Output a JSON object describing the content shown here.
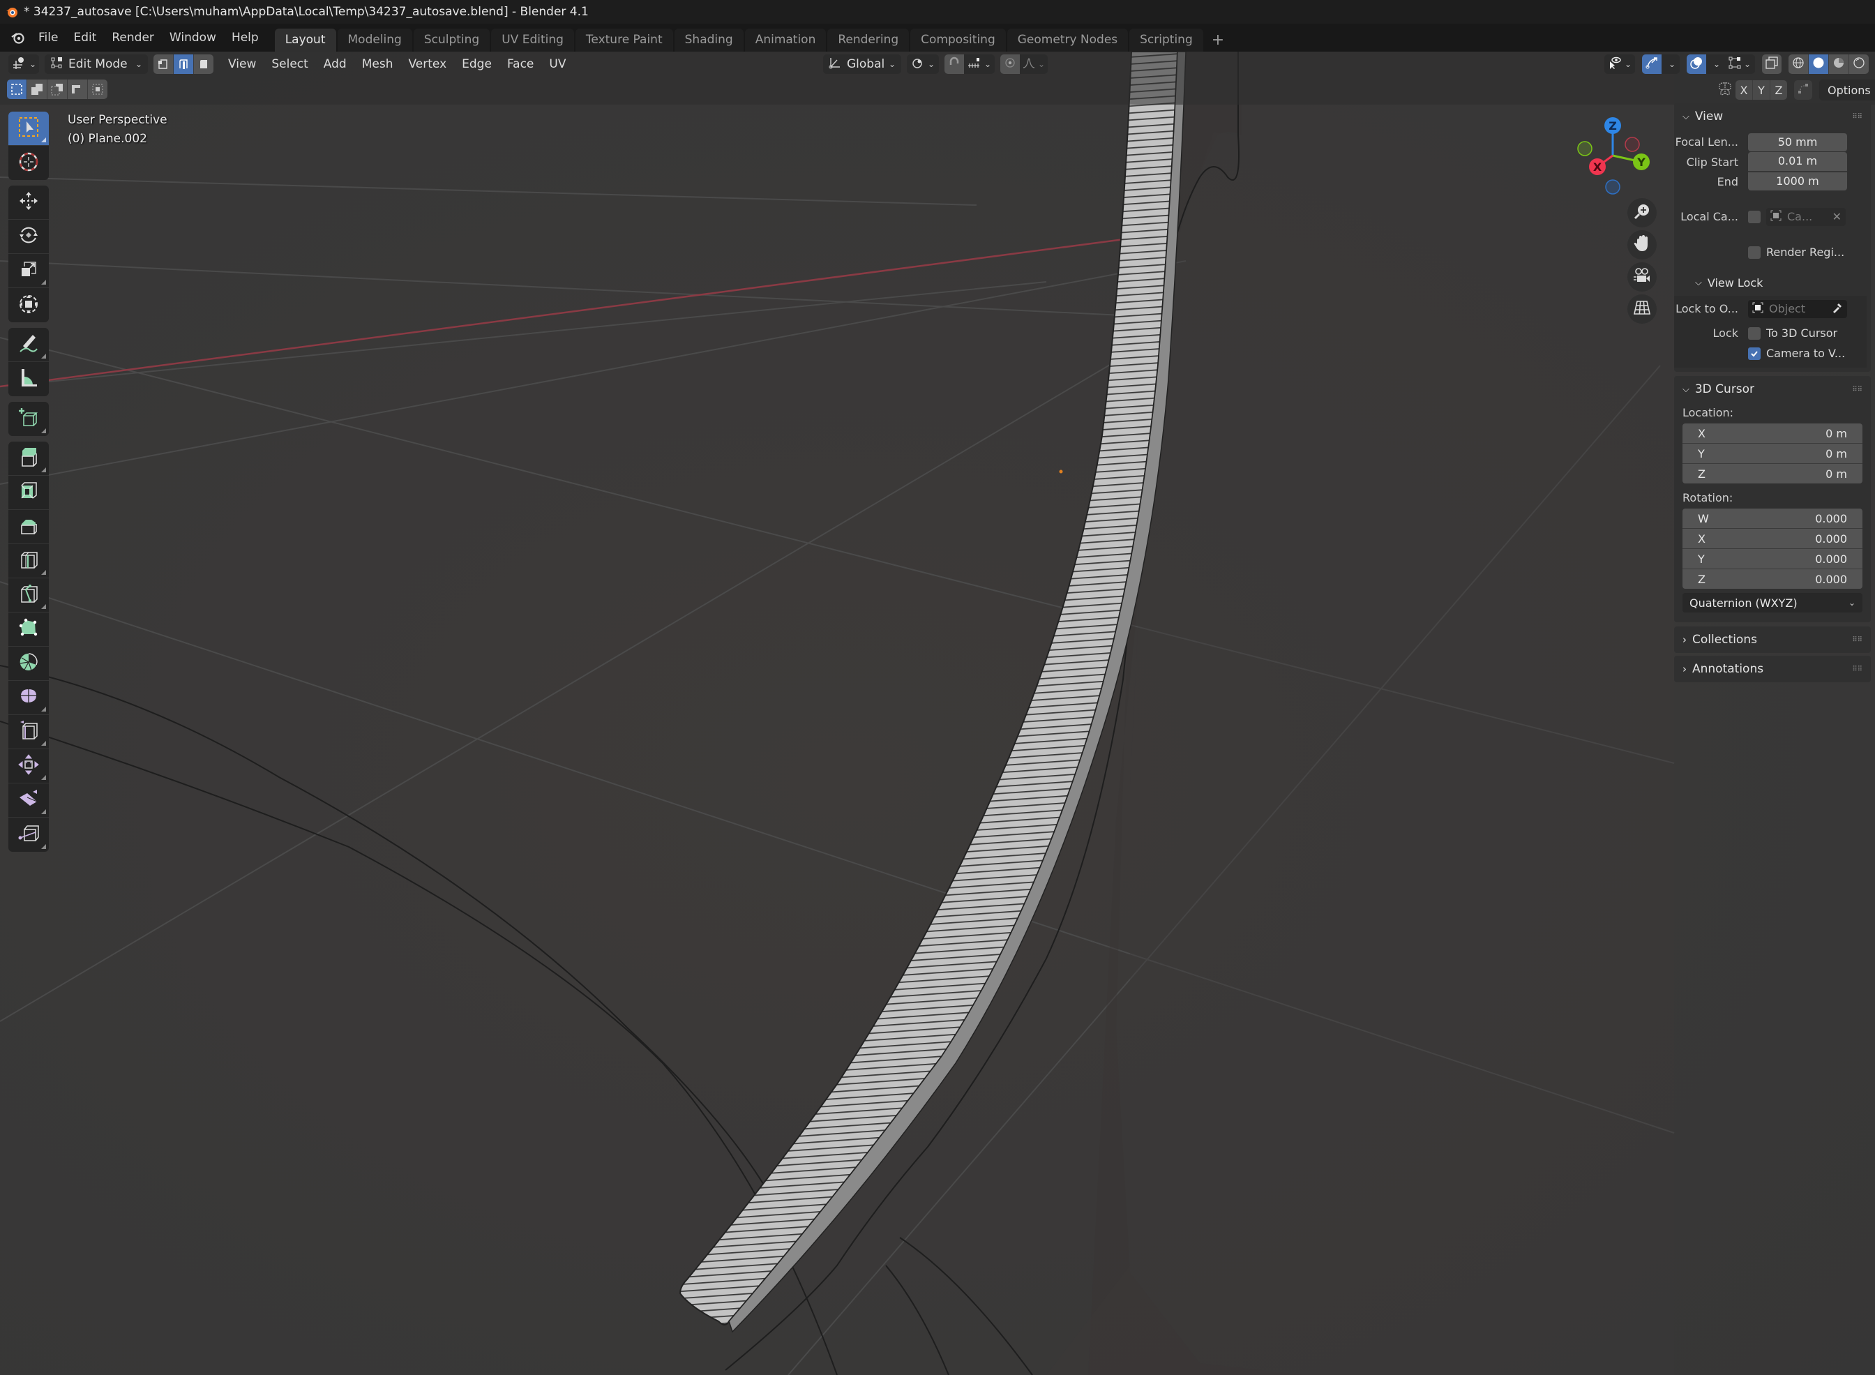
{
  "window": {
    "title": "* 34237_autosave [C:\\Users\\muham\\AppData\\Local\\Temp\\34237_autosave.blend] - Blender 4.1",
    "app_icon": "blender-logo-icon"
  },
  "menubar": {
    "items": [
      "File",
      "Edit",
      "Render",
      "Window",
      "Help"
    ]
  },
  "workspaces": {
    "tabs": [
      {
        "label": "Layout",
        "active": true
      },
      {
        "label": "Modeling",
        "active": false
      },
      {
        "label": "Sculpting",
        "active": false
      },
      {
        "label": "UV Editing",
        "active": false
      },
      {
        "label": "Texture Paint",
        "active": false
      },
      {
        "label": "Shading",
        "active": false
      },
      {
        "label": "Animation",
        "active": false
      },
      {
        "label": "Rendering",
        "active": false
      },
      {
        "label": "Compositing",
        "active": false
      },
      {
        "label": "Geometry Nodes",
        "active": false
      },
      {
        "label": "Scripting",
        "active": false
      }
    ],
    "add_label": "+"
  },
  "viewport_header": {
    "editor_type_icon": "3d-viewport-icon",
    "mode": "Edit Mode",
    "select_modes": [
      {
        "name": "vertex-select",
        "active": false
      },
      {
        "name": "edge-select",
        "active": true
      },
      {
        "name": "face-select",
        "active": false
      }
    ],
    "menus": [
      "View",
      "Select",
      "Add",
      "Mesh",
      "Vertex",
      "Edge",
      "Face",
      "UV"
    ],
    "transform_orientation": "Global",
    "pivot_icon": "pivot-point-icon",
    "snap_icon": "snap-magnet-icon",
    "snap_target_icon": "snap-increment-icon",
    "proportional_icon": "proportional-edit-icon",
    "falloff_icon": "falloff-curve-icon",
    "right_icons": [
      "visibility-selectability-icon",
      "gizmo-toggle-icon",
      "overlay-toggle-icon",
      "mesh-edit-overlay-icon",
      "xray-toggle-icon"
    ],
    "shading_modes": [
      {
        "name": "wireframe",
        "active": false
      },
      {
        "name": "solid",
        "active": true
      },
      {
        "name": "material-preview",
        "active": false
      },
      {
        "name": "rendered",
        "active": false
      }
    ]
  },
  "tool_settings": {
    "select_box_modes": [
      "set",
      "extend",
      "subtract",
      "difference",
      "intersect"
    ],
    "active_select_mode": 0,
    "mirror_axes": [
      "X",
      "Y",
      "Z"
    ],
    "options_label": "Options"
  },
  "toolbar": {
    "groups": [
      [
        "select-box",
        "cursor"
      ],
      [
        "move",
        "rotate",
        "scale",
        "transform"
      ],
      [
        "annotate",
        "measure"
      ],
      [
        "add-cube"
      ],
      [
        "extrude-region",
        "inset-faces",
        "bevel",
        "loop-cut",
        "knife",
        "poly-build",
        "spin",
        "smooth",
        "edge-slide",
        "shrink-fatten",
        "shear",
        "rip-region"
      ]
    ],
    "active": "select-box"
  },
  "viewport_overlay": {
    "view_name": "User Perspective",
    "object_name": "(0) Plane.002"
  },
  "nav_gizmo": {
    "axes": [
      {
        "label": "Z",
        "color": "#2e86e6"
      },
      {
        "label": "Y",
        "color": "#7bc516"
      },
      {
        "label": "X",
        "color": "#f0354f"
      }
    ],
    "buttons": [
      "zoom-icon",
      "pan-hand-icon",
      "camera-view-icon",
      "ortho-grid-icon"
    ]
  },
  "sidebar": {
    "view": {
      "title": "View",
      "focal_length_label": "Focal Len...",
      "focal_length": "50 mm",
      "clip_start_label": "Clip Start",
      "clip_start": "0.01 m",
      "clip_end_label": "End",
      "clip_end": "1000 m",
      "local_camera_label": "Local Ca...",
      "local_camera_checked": false,
      "local_camera_placeholder": "Ca...",
      "render_region_label": "Render Regi...",
      "render_region_checked": false
    },
    "view_lock": {
      "title": "View Lock",
      "lock_to_object_label": "Lock to O...",
      "lock_to_object_placeholder": "Object",
      "lock_label": "Lock",
      "to_3d_cursor_label": "To 3D Cursor",
      "to_3d_cursor_checked": false,
      "camera_to_view_label": "Camera to V...",
      "camera_to_view_checked": true
    },
    "cursor": {
      "title": "3D Cursor",
      "location_label": "Location:",
      "location": [
        {
          "axis": "X",
          "value": "0 m"
        },
        {
          "axis": "Y",
          "value": "0 m"
        },
        {
          "axis": "Z",
          "value": "0 m"
        }
      ],
      "rotation_label": "Rotation:",
      "rotation": [
        {
          "axis": "W",
          "value": "0.000"
        },
        {
          "axis": "X",
          "value": "0.000"
        },
        {
          "axis": "Y",
          "value": "0.000"
        },
        {
          "axis": "Z",
          "value": "0.000"
        }
      ],
      "rotation_mode": "Quaternion (WXYZ)"
    },
    "collapsed_panels": [
      "Collections",
      "Annotations"
    ]
  },
  "colors": {
    "accent": "#4772b3",
    "viewport_bg": "#3a3a3a",
    "x_axis": "#8a3a44",
    "tool_green": "#8fd6ad",
    "tool_purple": "#cdb8e6"
  }
}
